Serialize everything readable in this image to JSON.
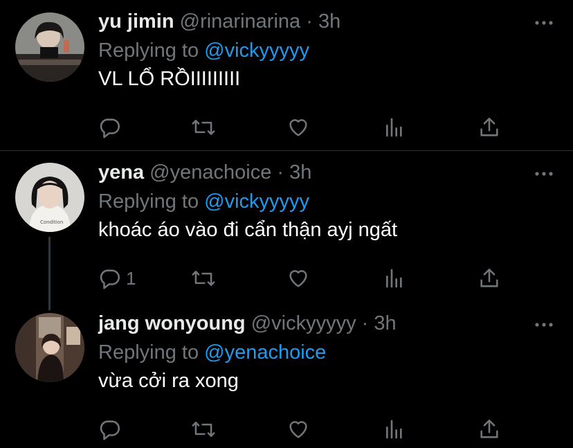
{
  "tweets": [
    {
      "name": "yu jimin",
      "handle": "@rinarinarina",
      "separator": "·",
      "time": "3h",
      "replying_label": "Replying to",
      "replying_to": "@vickyyyyy",
      "text": "VL LỔ RỒIIIIIIIII",
      "reply_count": ""
    },
    {
      "name": "yena",
      "handle": "@yenachoice",
      "separator": "·",
      "time": "3h",
      "replying_label": "Replying to",
      "replying_to": "@vickyyyyy",
      "text": "khoác áo vào đi cẩn thận ayj ngất",
      "reply_count": "1"
    },
    {
      "name": "jang wonyoung",
      "handle": "@vickyyyyy",
      "separator": "·",
      "time": "3h",
      "replying_label": "Replying to",
      "replying_to": "@yenachoice",
      "text": "vừa cởi ra xong",
      "reply_count": ""
    }
  ],
  "icons": [
    "reply-icon",
    "retweet-icon",
    "like-icon",
    "analytics-icon",
    "share-icon",
    "more-icon"
  ],
  "colors": {
    "background": "#000000",
    "text": "#e7e9ea",
    "muted": "#71767b",
    "link": "#1d9bf0",
    "divider": "#2f3336"
  }
}
